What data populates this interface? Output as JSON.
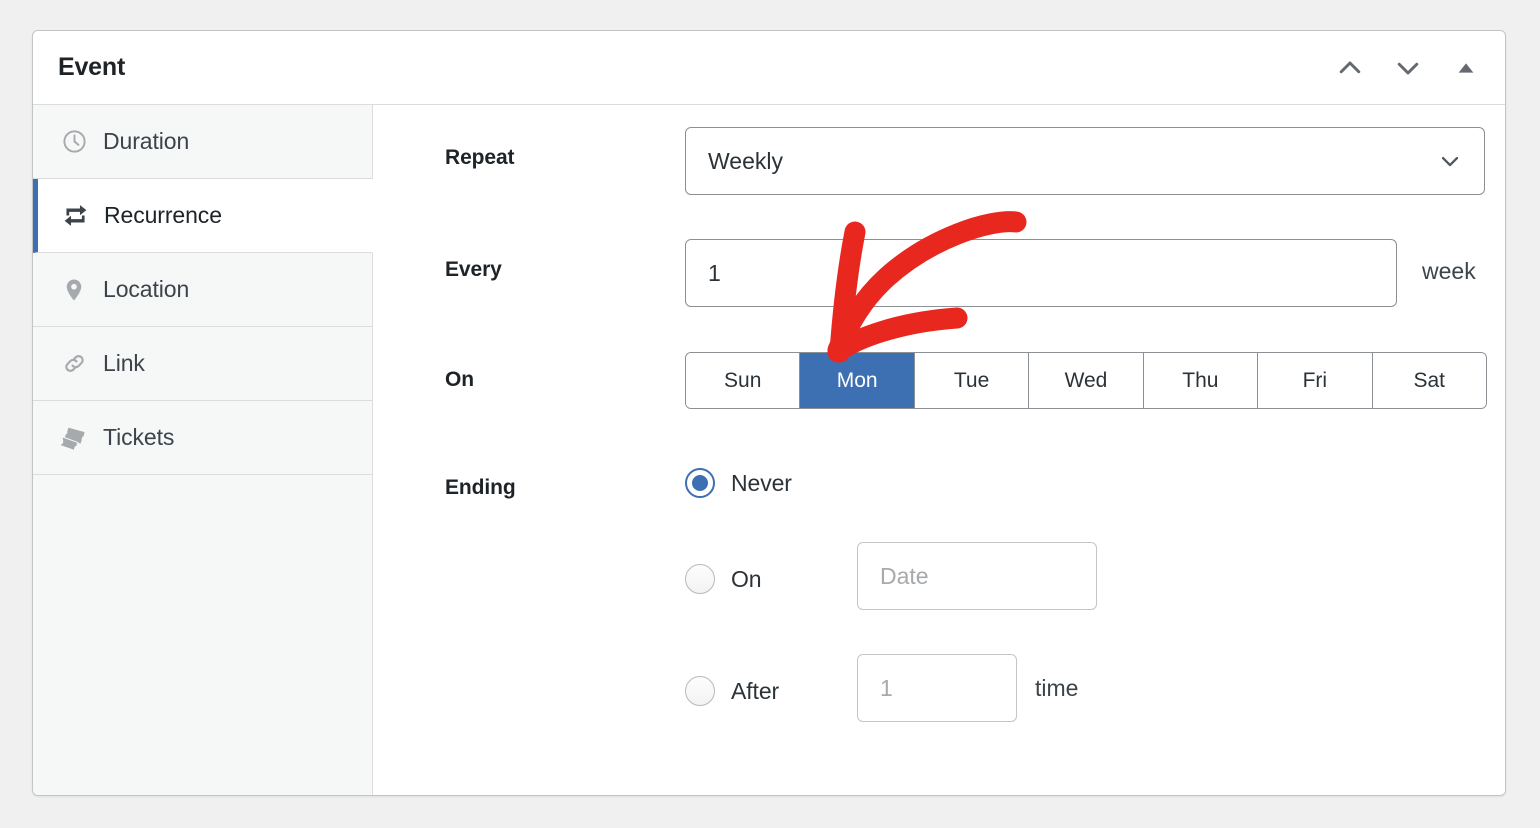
{
  "page": {
    "background_color": "#f0f0f1",
    "accent_color": "#3d70b2",
    "annotation_color": "#e8281e"
  },
  "header": {
    "title": "Event",
    "actions": [
      {
        "name": "move-up-button",
        "icon": "chevron-up-icon"
      },
      {
        "name": "move-down-button",
        "icon": "chevron-down-icon"
      },
      {
        "name": "collapse-button",
        "icon": "triangle-up-icon"
      }
    ]
  },
  "sidebar": {
    "items": [
      {
        "label": "Duration",
        "icon": "clock-icon",
        "active": false
      },
      {
        "label": "Recurrence",
        "icon": "repeat-icon",
        "active": true
      },
      {
        "label": "Location",
        "icon": "map-pin-icon",
        "active": false
      },
      {
        "label": "Link",
        "icon": "link-icon",
        "active": false
      },
      {
        "label": "Tickets",
        "icon": "tickets-icon",
        "active": false
      }
    ]
  },
  "form": {
    "repeat": {
      "label": "Repeat",
      "value": "Weekly",
      "options": [
        "Weekly"
      ]
    },
    "every": {
      "label": "Every",
      "value": "1",
      "unit": "week"
    },
    "on": {
      "label": "On",
      "days": [
        {
          "label": "Sun",
          "selected": false
        },
        {
          "label": "Mon",
          "selected": true
        },
        {
          "label": "Tue",
          "selected": false
        },
        {
          "label": "Wed",
          "selected": false
        },
        {
          "label": "Thu",
          "selected": false
        },
        {
          "label": "Fri",
          "selected": false
        },
        {
          "label": "Sat",
          "selected": false
        }
      ]
    },
    "ending": {
      "label": "Ending",
      "never": {
        "label": "Never",
        "checked": true
      },
      "on": {
        "label": "On",
        "checked": false,
        "date_value": "",
        "date_placeholder": "Date"
      },
      "after": {
        "label": "After",
        "checked": false,
        "count_value": "",
        "count_placeholder": "1",
        "unit": "time"
      }
    }
  }
}
